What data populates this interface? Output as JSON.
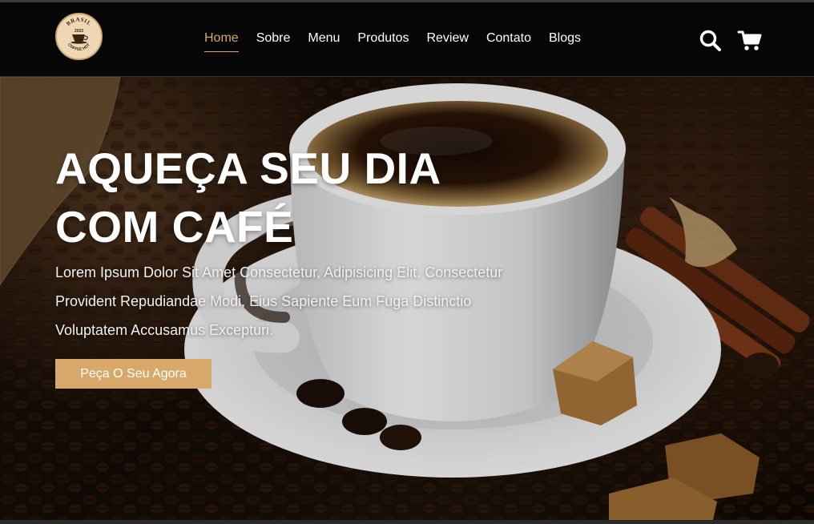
{
  "logo": {
    "top_text": "BRASIL",
    "year": "2023",
    "bottom_text": "COFFEE HOT"
  },
  "nav": {
    "items": [
      {
        "label": "Home",
        "active": true
      },
      {
        "label": "Sobre",
        "active": false
      },
      {
        "label": "Menu",
        "active": false
      },
      {
        "label": "Produtos",
        "active": false
      },
      {
        "label": "Review",
        "active": false
      },
      {
        "label": "Contato",
        "active": false
      },
      {
        "label": "Blogs",
        "active": false
      }
    ]
  },
  "header_icons": {
    "search": "search-icon",
    "cart": "shopping-cart-icon"
  },
  "hero": {
    "title_line1": "AQUEÇA SEU DIA",
    "title_line2": "COM CAFÉ",
    "text_line1": "Lorem Ipsum Dolor Sit Amet Consectetur, Adipisicing Elit. Consectetur",
    "text_line2": "Provident Repudiandae Modi, Eius Sapiente Eum Fuga Distinctio",
    "text_line3": "Voluptatem Accusamus Excepturi.",
    "cta_label": "Peça O Seu Agora"
  },
  "colors": {
    "accent": "#d8a86a",
    "header_bg": "#060606",
    "text": "#ffffff"
  }
}
